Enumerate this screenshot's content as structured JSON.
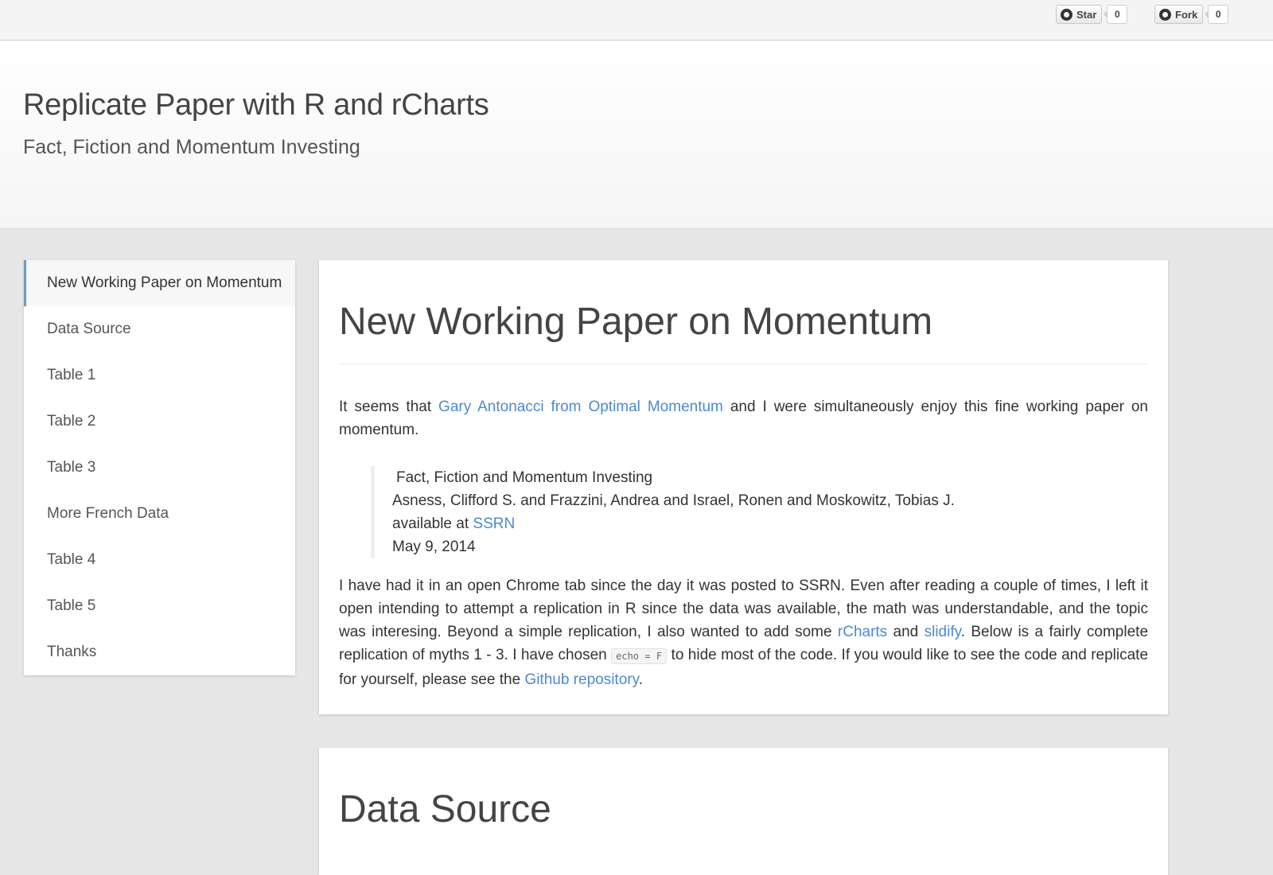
{
  "github": {
    "star_label": "Star",
    "star_count": "0",
    "fork_label": "Fork",
    "fork_count": "0"
  },
  "header": {
    "title": "Replicate Paper with R and rCharts",
    "subtitle": "Fact, Fiction and Momentum Investing"
  },
  "sidebar": {
    "items": [
      {
        "label": "New Working Paper on Momentum"
      },
      {
        "label": "Data Source"
      },
      {
        "label": "Table 1"
      },
      {
        "label": "Table 2"
      },
      {
        "label": "Table 3"
      },
      {
        "label": "More French Data"
      },
      {
        "label": "Table 4"
      },
      {
        "label": "Table 5"
      },
      {
        "label": "Thanks"
      }
    ]
  },
  "section1": {
    "heading": "New Working Paper on Momentum",
    "p1_before": "It seems that ",
    "p1_link": "Gary Antonacci from Optimal Momentum",
    "p1_after": " and I were simultaneously enjoy this fine working paper on momentum.",
    "quote": {
      "title": "Fact, Fiction and Momentum Investing",
      "authors": "Asness, Clifford S. and Frazzini, Andrea and Israel, Ronen and Moskowitz, Tobias J.",
      "available_prefix": "available at ",
      "available_link": "SSRN",
      "date": "May 9, 2014"
    },
    "p2_a": "I have had it in an open Chrome tab since the day it was posted to SSRN. Even after reading a couple of times, I left it open intending to attempt a replication in R since the data was available, the math was understandable, and the topic was interesing. Beyond a simple replication, I also wanted to add some ",
    "p2_link1": "rCharts",
    "p2_b": " and ",
    "p2_link2": "slidify",
    "p2_c": ". Below is a fairly complete replication of myths 1 - 3. I have chosen ",
    "p2_code": "echo = F",
    "p2_d": " to hide most of the code. If you would like to see the code and replicate for yourself, please see the ",
    "p2_link3": "Github repository",
    "p2_e": "."
  },
  "section2": {
    "heading": "Data Source"
  }
}
